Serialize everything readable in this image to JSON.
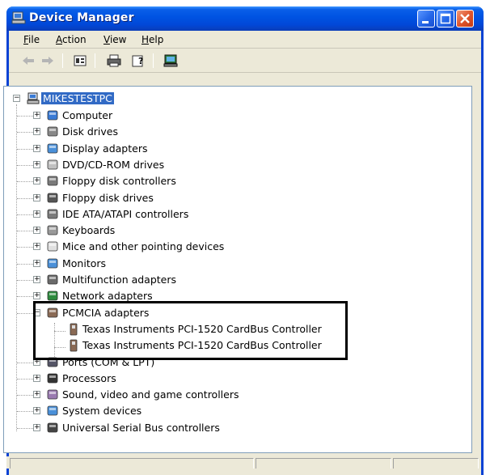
{
  "window": {
    "title": "Device Manager"
  },
  "menu": [
    {
      "label": "File",
      "accel": "F",
      "rest": "ile"
    },
    {
      "label": "Action",
      "accel": "A",
      "rest": "ction"
    },
    {
      "label": "View",
      "accel": "V",
      "rest": "iew"
    },
    {
      "label": "Help",
      "accel": "H",
      "rest": "elp"
    }
  ],
  "toolbar": {
    "buttons": [
      "back-icon",
      "forward-icon",
      "properties-icon",
      "print-icon",
      "help-icon",
      "update-driver-icon"
    ]
  },
  "tree": {
    "root": {
      "label": "MIKESTESTPC",
      "icon": "computer-icon"
    },
    "categories": [
      {
        "label": "Computer",
        "icon": "computer-icon"
      },
      {
        "label": "Disk drives",
        "icon": "disk-drive-icon"
      },
      {
        "label": "Display adapters",
        "icon": "display-adapter-icon"
      },
      {
        "label": "DVD/CD-ROM drives",
        "icon": "cdrom-icon"
      },
      {
        "label": "Floppy disk controllers",
        "icon": "controller-icon"
      },
      {
        "label": "Floppy disk drives",
        "icon": "floppy-icon"
      },
      {
        "label": "IDE ATA/ATAPI controllers",
        "icon": "controller-icon"
      },
      {
        "label": "Keyboards",
        "icon": "keyboard-icon"
      },
      {
        "label": "Mice and other pointing devices",
        "icon": "mouse-icon"
      },
      {
        "label": "Monitors",
        "icon": "monitor-icon"
      },
      {
        "label": "Multifunction adapters",
        "icon": "multifunction-icon"
      },
      {
        "label": "Network adapters",
        "icon": "network-icon"
      },
      {
        "label": "PCMCIA adapters",
        "icon": "pcmcia-icon",
        "expanded": true,
        "children": [
          {
            "label": "Texas Instruments PCI-1520 CardBus Controller",
            "icon": "pcmcia-icon"
          },
          {
            "label": "Texas Instruments PCI-1520 CardBus Controller",
            "icon": "pcmcia-icon"
          }
        ]
      },
      {
        "label": "Ports (COM & LPT)",
        "icon": "port-icon"
      },
      {
        "label": "Processors",
        "icon": "processor-icon"
      },
      {
        "label": "Sound, video and game controllers",
        "icon": "sound-icon"
      },
      {
        "label": "System devices",
        "icon": "system-icon"
      },
      {
        "label": "Universal Serial Bus controllers",
        "icon": "usb-icon"
      }
    ]
  },
  "colors": {
    "titlebar": "#0054e3",
    "selection": "#316ac5",
    "highlight_border": "#000000"
  }
}
